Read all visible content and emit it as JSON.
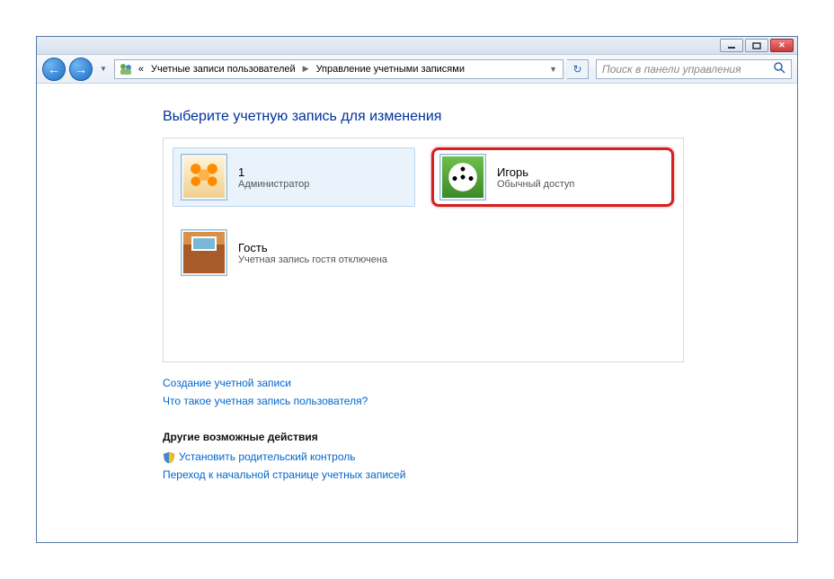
{
  "breadcrumb": {
    "chevrons": "«",
    "item1": "Учетные записи пользователей",
    "item2": "Управление учетными записями"
  },
  "search": {
    "placeholder": "Поиск в панели управления"
  },
  "page": {
    "title": "Выберите учетную запись для изменения"
  },
  "accounts": [
    {
      "name": "1",
      "role": "Администратор"
    },
    {
      "name": "Игорь",
      "role": "Обычный доступ"
    },
    {
      "name": "Гость",
      "role": "Учетная запись гостя отключена"
    }
  ],
  "links": {
    "create": "Создание учетной записи",
    "what": "Что такое учетная запись пользователя?"
  },
  "other": {
    "heading": "Другие возможные действия",
    "parental": "Установить родительский контроль",
    "gohome": "Переход к начальной странице учетных записей"
  }
}
